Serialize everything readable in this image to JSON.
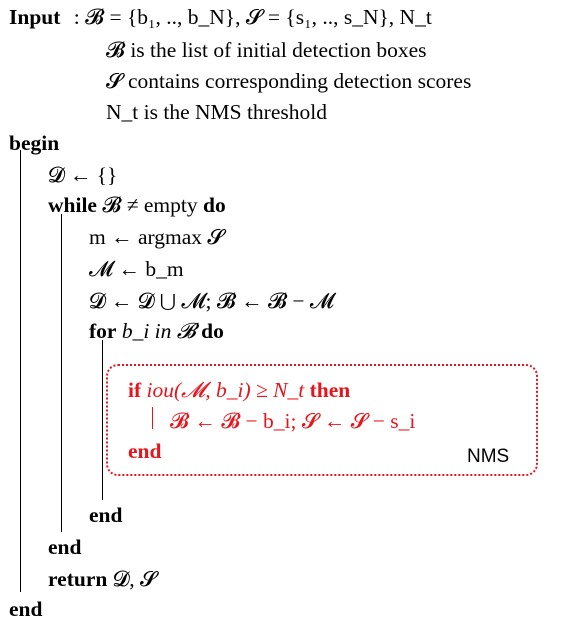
{
  "algorithm": {
    "input_keyword": "Input",
    "input_spec": ": 𝓑 = {b₁, .., b_N}, 𝓢 = {s₁, .., s_N}, N_t",
    "desc_boxes": "𝓑 is the list of initial detection boxes",
    "desc_scores": "𝓢 contains corresponding detection scores",
    "desc_threshold": "N_t is the NMS threshold",
    "begin_keyword": "begin",
    "init_line": "𝓓 ← {}",
    "while_keyword": "while",
    "while_cond": "𝓑 ≠ empty",
    "do_keyword": "do",
    "argmax_line": "m ← argmax 𝓢",
    "assign_m_line": "𝓜 ← b_m",
    "update_line": "𝓓 ← 𝓓 ⋃ 𝓜; 𝓑 ← 𝓑 − 𝓜",
    "for_keyword": "for",
    "for_cond": "b_i in 𝓑",
    "for_do_keyword": "do",
    "if_keyword": "if",
    "if_cond": "iou(𝓜, b_i) ≥ N_t",
    "then_keyword": "then",
    "remove_line": "𝓑 ← 𝓑 − b_i; 𝓢 ← 𝓢 − s_i",
    "if_end": "end",
    "for_end": "end",
    "while_end": "end",
    "return_keyword": "return",
    "return_values": "𝓓, 𝓢",
    "begin_end": "end",
    "nms_label": "NMS"
  },
  "colors": {
    "text": "#000000",
    "highlight": "#e8141b"
  }
}
